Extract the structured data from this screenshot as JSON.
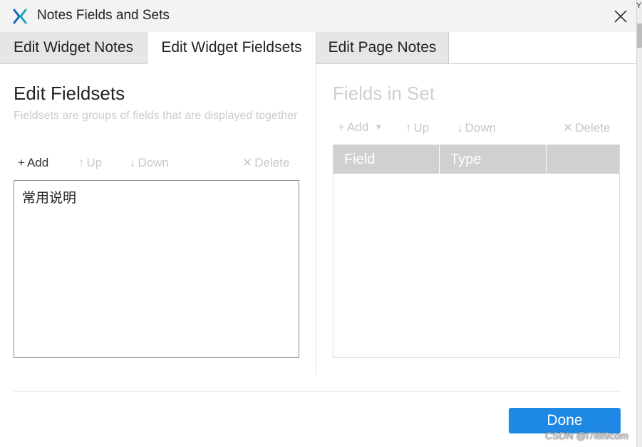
{
  "window": {
    "title": "Notes Fields and Sets"
  },
  "tabs": [
    {
      "label": "Edit Widget Notes",
      "active": false
    },
    {
      "label": "Edit Widget Fieldsets",
      "active": true
    },
    {
      "label": "Edit Page Notes",
      "active": false
    }
  ],
  "left_panel": {
    "heading": "Edit Fieldsets",
    "description": "Fieldsets are groups of fields that are displayed together",
    "toolbar": {
      "add": "Add",
      "up": "Up",
      "down": "Down",
      "delete": "Delete"
    },
    "fieldsets": [
      "常用说明"
    ]
  },
  "right_panel": {
    "heading": "Fields in Set",
    "toolbar": {
      "add": "Add",
      "up": "Up",
      "down": "Down",
      "delete": "Delete"
    },
    "columns": [
      "Field",
      "Type",
      ""
    ]
  },
  "footer": {
    "done": "Done"
  },
  "watermark": "CSDN @i7i8i9com",
  "edge_glyph": "Y",
  "colors": {
    "accent": "#1e88e5",
    "logo_teal": "#1aa6b7",
    "logo_blue": "#1565c0"
  }
}
